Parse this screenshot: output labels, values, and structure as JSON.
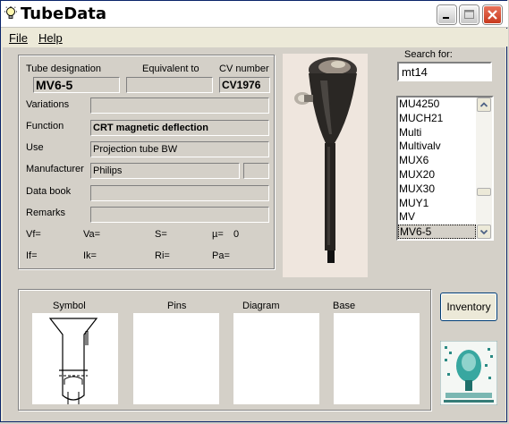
{
  "window": {
    "title": "TubeData"
  },
  "menu": {
    "file": "File",
    "help": "Help"
  },
  "form": {
    "tube_designation_label": "Tube designation",
    "tube_designation": "MV6-5",
    "equivalent_label": "Equivalent to",
    "equivalent": "",
    "cv_label": "CV number",
    "cv": "CV1976",
    "variations_label": "Variations",
    "variations": "",
    "function_label": "Function",
    "function": "CRT magnetic deflection",
    "use_label": "Use",
    "use": "Projection tube BW",
    "manufacturer_label": "Manufacturer",
    "manufacturer": "Philips",
    "manufacturer_extra": "",
    "databook_label": "Data book",
    "databook": "",
    "remarks_label": "Remarks",
    "remarks": "",
    "params": {
      "vf": "Vf=",
      "va": "Va=",
      "s": "S=",
      "mu": "µ=",
      "mu_value": "0",
      "if": "If=",
      "ik": "Ik=",
      "ri": "Ri=",
      "pa": "Pa="
    }
  },
  "search": {
    "label": "Search for:",
    "value": "mt14",
    "items": [
      "MU4250",
      "MUCH21",
      "Multi",
      "Multivalv",
      "MUX6",
      "MUX20",
      "MUX30",
      "MUY1",
      "MV",
      "MV6-5"
    ],
    "selected": "MV6-5"
  },
  "bottom": {
    "symbol_label": "Symbol",
    "pins_label": "Pins",
    "diagram_label": "Diagram",
    "base_label": "Base",
    "inventory_button": "Inventory"
  },
  "colors": {
    "title_bar": "#ffffff",
    "close_button": "#d2401f",
    "background": "#d4d0c8",
    "selection": "#d4d0c8"
  },
  "icons": [
    "lightbulb-icon",
    "minimize-icon",
    "maximize-icon",
    "close-icon",
    "scroll-up-icon",
    "scroll-down-icon",
    "tube-photo",
    "tube-symbol",
    "tube-logo"
  ]
}
